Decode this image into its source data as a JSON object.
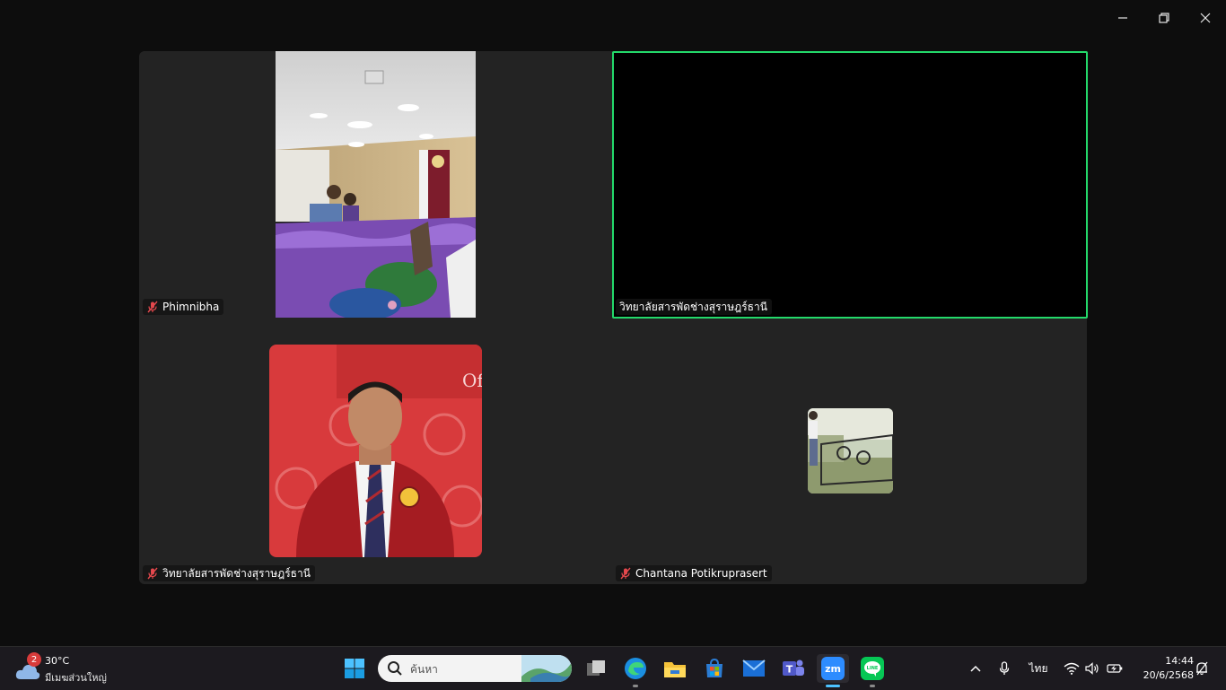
{
  "window_controls": {
    "minimize": "minimize",
    "restore": "restore",
    "close": "close"
  },
  "participants": [
    {
      "name": "Phimnibha",
      "muted": true
    },
    {
      "name": "วิทยาลัยสารพัดช่างสุราษฎร์ธานี",
      "muted": false,
      "active_speaker": true
    },
    {
      "name": "วิทยาลัยสารพัดช่างสุราษฎร์ธานี",
      "muted": true
    },
    {
      "name": "Chantana Potikruprasert",
      "muted": true
    }
  ],
  "taskbar": {
    "weather": {
      "badge": "2",
      "temp": "30°C",
      "desc": "มีเมฆส่วนใหญ่"
    },
    "search_placeholder": "ค้นหา",
    "apps": [
      "start-icon",
      "task-view-icon",
      "edge-icon",
      "file-explorer-icon",
      "store-icon",
      "mail-icon",
      "teams-icon",
      "zoom-icon",
      "line-icon"
    ],
    "zoom_label": "zm",
    "line_label": "LINE",
    "language": "ไทย",
    "time": "14:44",
    "date": "20/6/2568"
  },
  "colors": {
    "active_border": "#23d96a",
    "mute_icon": "#e5484d",
    "zoom_blue": "#2d8cff",
    "line_green": "#06c755"
  }
}
